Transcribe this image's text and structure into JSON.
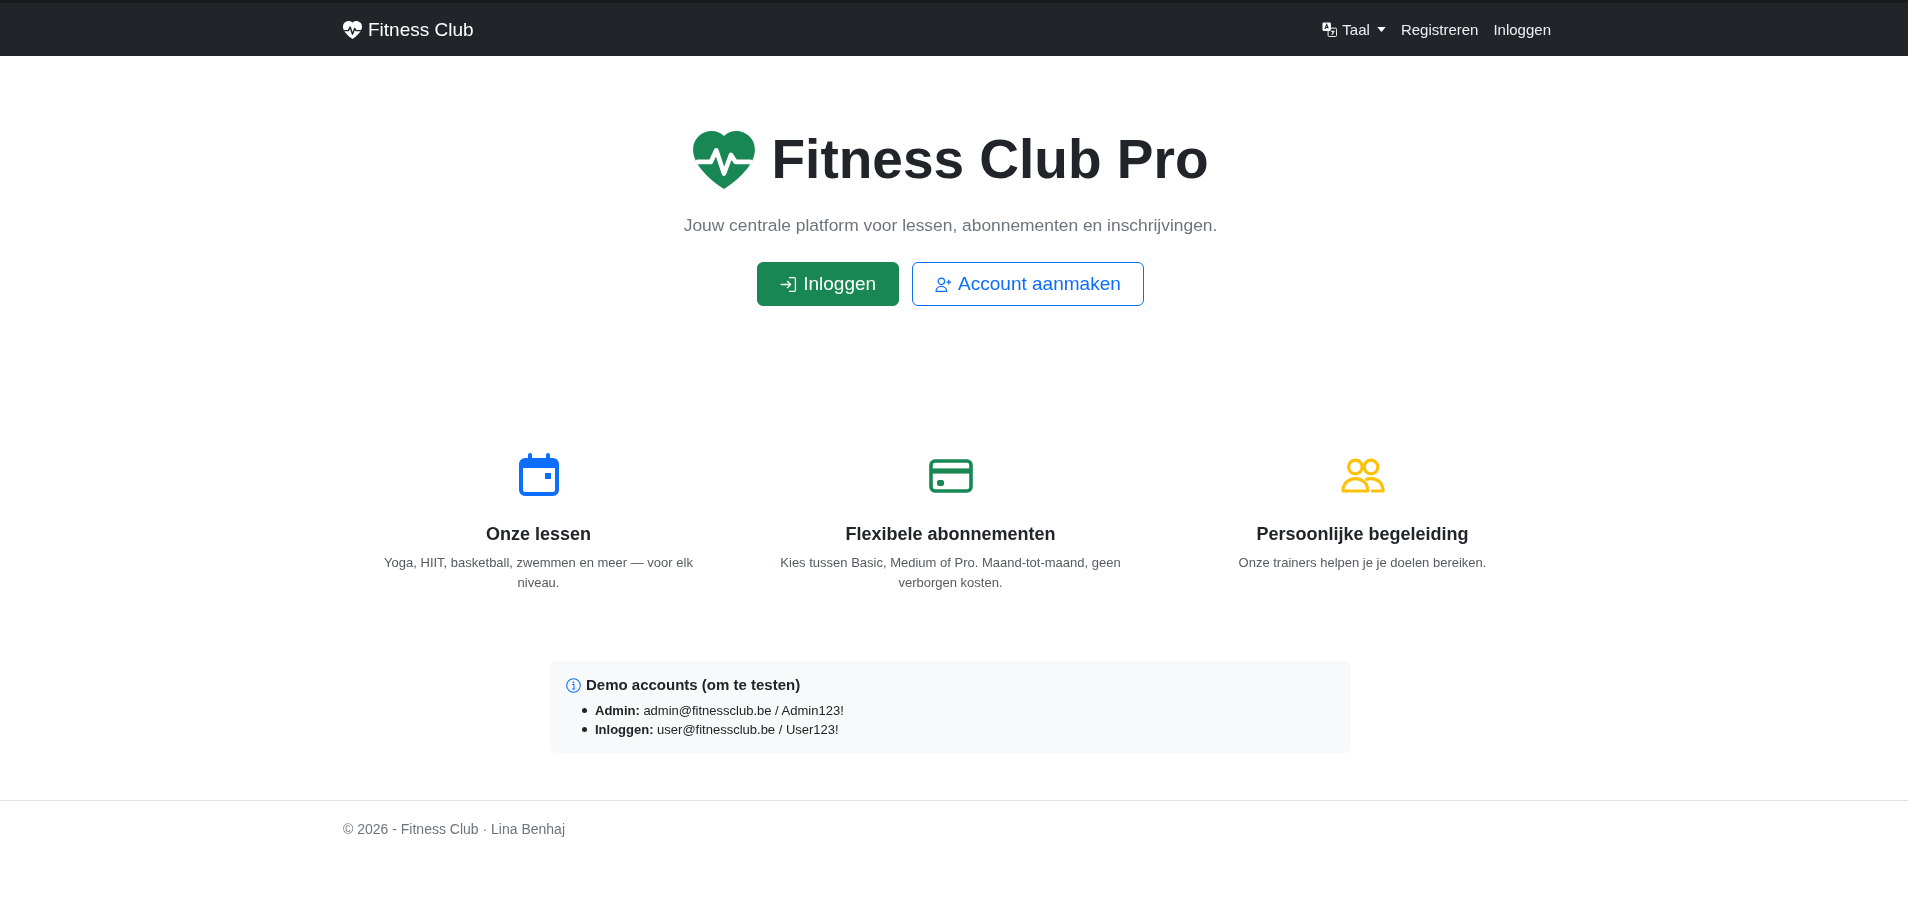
{
  "navbar": {
    "brand": "Fitness Club",
    "language_menu": {
      "label": "Taal"
    },
    "links": [
      {
        "label": "Registreren"
      },
      {
        "label": "Inloggen"
      }
    ]
  },
  "hero": {
    "title": "Fitness Club Pro",
    "subtitle": "Jouw centrale platform voor lessen, abonnementen en inschrijvingen.",
    "buttons": [
      {
        "label": "Inloggen",
        "kind": "primary"
      },
      {
        "label": "Account aanmaken",
        "kind": "outline"
      }
    ]
  },
  "features": [
    {
      "kind": "lessons",
      "color": "#0d6efd",
      "title": "Onze lessen",
      "description": "Yoga, HIIT, basketball, zwemmen en meer — voor elk niveau."
    },
    {
      "kind": "subscriptions",
      "color": "#198754",
      "title": "Flexibele abonnementen",
      "description": "Kies tussen Basic, Medium of Pro. Maand-tot-maand, geen verborgen kosten."
    },
    {
      "kind": "coaching",
      "color": "#ffc107",
      "title": "Persoonlijke begeleiding",
      "description": "Onze trainers helpen je je doelen bereiken."
    }
  ],
  "demo_accounts": {
    "title": "Demo accounts (om te testen)",
    "accounts": [
      "**Admin:** admin@fitnessclub.be / Admin123!",
      "**Inloggen:** user@fitnessclub.be / User123!"
    ]
  },
  "footer": {
    "text": "© 2026 - Fitness Club · Lina Benhaj"
  }
}
